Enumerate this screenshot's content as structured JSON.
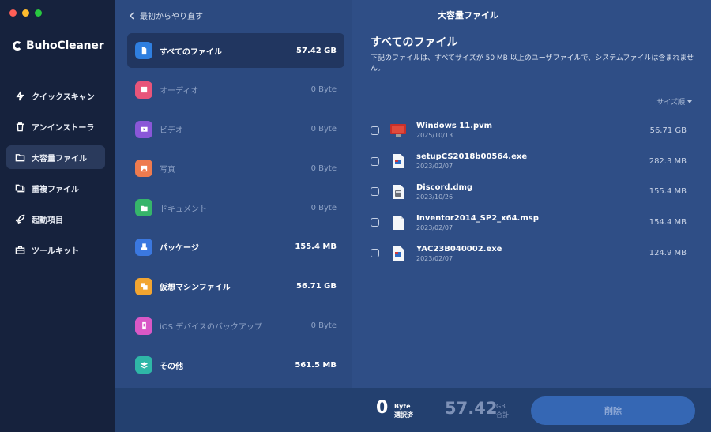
{
  "app": {
    "brand": "BuhoCleaner",
    "window_title": "大容量ファイル",
    "traffic_colors": [
      "#ff5f57",
      "#febc2e",
      "#28c840"
    ]
  },
  "sidebar": {
    "items": [
      {
        "label": "クイックスキャン",
        "icon": "lightning-icon",
        "active": false
      },
      {
        "label": "アンインストーラ",
        "icon": "trash-icon",
        "active": false
      },
      {
        "label": "大容量ファイル",
        "icon": "folder-icon",
        "active": true
      },
      {
        "label": "重複ファイル",
        "icon": "folders-icon",
        "active": false
      },
      {
        "label": "起動項目",
        "icon": "rocket-icon",
        "active": false
      },
      {
        "label": "ツールキット",
        "icon": "toolkit-icon",
        "active": false
      }
    ]
  },
  "middle": {
    "back_label": "最初からやり直す",
    "categories": [
      {
        "label": "すべてのファイル",
        "size": "57.42 GB",
        "icon": "all-files-icon",
        "color": "#2f7fe0",
        "active": true,
        "dim": false
      },
      {
        "label": "オーディオ",
        "size": "0 Byte",
        "icon": "audio-icon",
        "color": "#e8557a",
        "active": false,
        "dim": true
      },
      {
        "label": "ビデオ",
        "size": "0 Byte",
        "icon": "video-icon",
        "color": "#8a57d8",
        "active": false,
        "dim": true
      },
      {
        "label": "写真",
        "size": "0 Byte",
        "icon": "photo-icon",
        "color": "#ee7b4f",
        "active": false,
        "dim": true
      },
      {
        "label": "ドキュメント",
        "size": "0 Byte",
        "icon": "document-icon",
        "color": "#36b56a",
        "active": false,
        "dim": true
      },
      {
        "label": "パッケージ",
        "size": "155.4 MB",
        "icon": "package-icon",
        "color": "#3b78e0",
        "active": false,
        "dim": false
      },
      {
        "label": "仮想マシンファイル",
        "size": "56.71 GB",
        "icon": "virtual-machine-icon",
        "color": "#f2a531",
        "active": false,
        "dim": false
      },
      {
        "label": "iOS デバイスのバックアップ",
        "size": "0 Byte",
        "icon": "ios-backup-icon",
        "color": "#d958c6",
        "active": false,
        "dim": true
      },
      {
        "label": "その他",
        "size": "561.5 MB",
        "icon": "other-icon",
        "color": "#2fb7a7",
        "active": false,
        "dim": false
      }
    ]
  },
  "main": {
    "title": "すべてのファイル",
    "description": "下記のファイルは、すべてサイズが 50 MB 以上のユーザファイルで、システムファイルは含まれません。",
    "sort_label": "サイズ順",
    "files": [
      {
        "name": "Windows 11.pvm",
        "date": "2025/10/13",
        "size": "56.71 GB",
        "icon": "parallels-vm-icon"
      },
      {
        "name": "setupCS2018b00564.exe",
        "date": "2023/02/07",
        "size": "282.3 MB",
        "icon": "exe-file-icon"
      },
      {
        "name": "Discord.dmg",
        "date": "2023/10/26",
        "size": "155.4 MB",
        "icon": "dmg-file-icon"
      },
      {
        "name": "Inventor2014_SP2_x64.msp",
        "date": "2023/02/07",
        "size": "154.4 MB",
        "icon": "blank-file-icon"
      },
      {
        "name": "YAC23B040002.exe",
        "date": "2023/02/07",
        "size": "124.9 MB",
        "icon": "exe-file-icon"
      }
    ]
  },
  "footer": {
    "selected_value": "0",
    "selected_unit": "Byte",
    "selected_label": "選択済",
    "total_value": "57.42",
    "total_unit": "GB",
    "total_label": "合計",
    "delete_label": "削除"
  }
}
